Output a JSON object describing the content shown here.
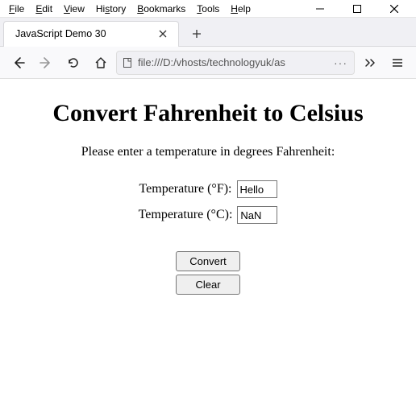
{
  "menu": {
    "file": "File",
    "edit": "Edit",
    "view": "View",
    "history": "History",
    "bookmarks": "Bookmarks",
    "tools": "Tools",
    "help": "Help"
  },
  "tab": {
    "title": "JavaScript Demo 30"
  },
  "url": "file:///D:/vhosts/technologyuk/as",
  "page": {
    "heading": "Convert Fahrenheit to Celsius",
    "prompt": "Please enter a temperature in degrees Fahrenheit:",
    "label_f": "Temperature (°F):",
    "label_c": "Temperature (°C):",
    "value_f": "Hello",
    "value_c": "NaN",
    "btn_convert": "Convert",
    "btn_clear": "Clear"
  }
}
